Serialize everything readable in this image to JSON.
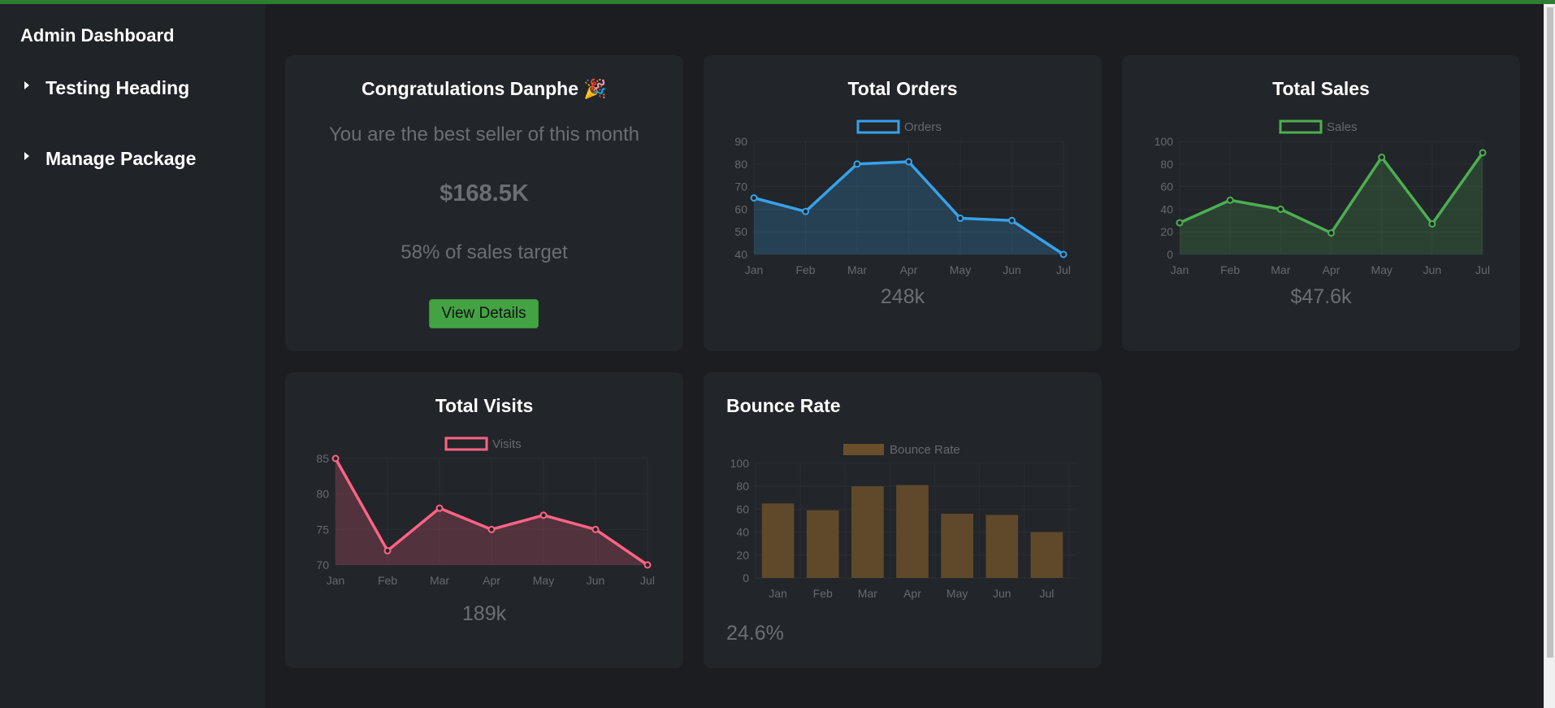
{
  "sidebar": {
    "brand": "Admin Dashboard",
    "items": [
      {
        "label": "Testing Heading"
      },
      {
        "label": "Manage Package"
      }
    ]
  },
  "welcome": {
    "title": "Congratulations Danphe 🎉",
    "subtitle": "You are the best seller of this month",
    "amount": "$168.5K",
    "target": "58% of sales target",
    "button": "View Details"
  },
  "cards": {
    "orders": {
      "title": "Total Orders",
      "total": "248k"
    },
    "sales": {
      "title": "Total Sales",
      "total": "$47.6k"
    },
    "visits": {
      "title": "Total Visits",
      "total": "189k"
    },
    "bounce": {
      "title": "Bounce Rate",
      "total": "24.6%"
    }
  },
  "colors": {
    "orders": "#36a2eb",
    "sales": "#4caf50",
    "visits": "#ff6384",
    "bounce": "#6b4f2a"
  },
  "chart_data": [
    {
      "id": "orders",
      "type": "line",
      "legend": "Orders",
      "categories": [
        "Jan",
        "Feb",
        "Mar",
        "Apr",
        "May",
        "Jun",
        "Jul"
      ],
      "series": [
        {
          "name": "Orders",
          "values": [
            65,
            59,
            80,
            81,
            56,
            55,
            40
          ]
        }
      ],
      "ylim": [
        40,
        90
      ],
      "yticks": [
        40,
        50,
        60,
        70,
        80,
        90
      ],
      "fill": true,
      "grid": true
    },
    {
      "id": "sales",
      "type": "line",
      "legend": "Sales",
      "categories": [
        "Jan",
        "Feb",
        "Mar",
        "Apr",
        "May",
        "Jun",
        "Jul"
      ],
      "series": [
        {
          "name": "Sales",
          "values": [
            28,
            48,
            40,
            19,
            86,
            27,
            90
          ]
        }
      ],
      "ylim": [
        0,
        100
      ],
      "yticks": [
        0,
        20,
        40,
        60,
        80,
        100
      ],
      "fill": true,
      "grid": true
    },
    {
      "id": "visits",
      "type": "line",
      "legend": "Visits",
      "categories": [
        "Jan",
        "Feb",
        "Mar",
        "Apr",
        "May",
        "Jun",
        "Jul"
      ],
      "series": [
        {
          "name": "Visits",
          "values": [
            85,
            72,
            78,
            75,
            77,
            75,
            70
          ]
        }
      ],
      "ylim": [
        70,
        85
      ],
      "yticks": [
        70,
        75,
        80,
        85
      ],
      "fill": true,
      "grid": true
    },
    {
      "id": "bounce",
      "type": "bar",
      "legend": "Bounce Rate",
      "categories": [
        "Jan",
        "Feb",
        "Mar",
        "Apr",
        "May",
        "Jun",
        "Jul"
      ],
      "series": [
        {
          "name": "Bounce Rate",
          "values": [
            65,
            59,
            80,
            81,
            56,
            55,
            40
          ]
        }
      ],
      "ylim": [
        0,
        100
      ],
      "yticks": [
        0,
        20,
        40,
        60,
        80,
        100
      ],
      "grid": true
    }
  ]
}
